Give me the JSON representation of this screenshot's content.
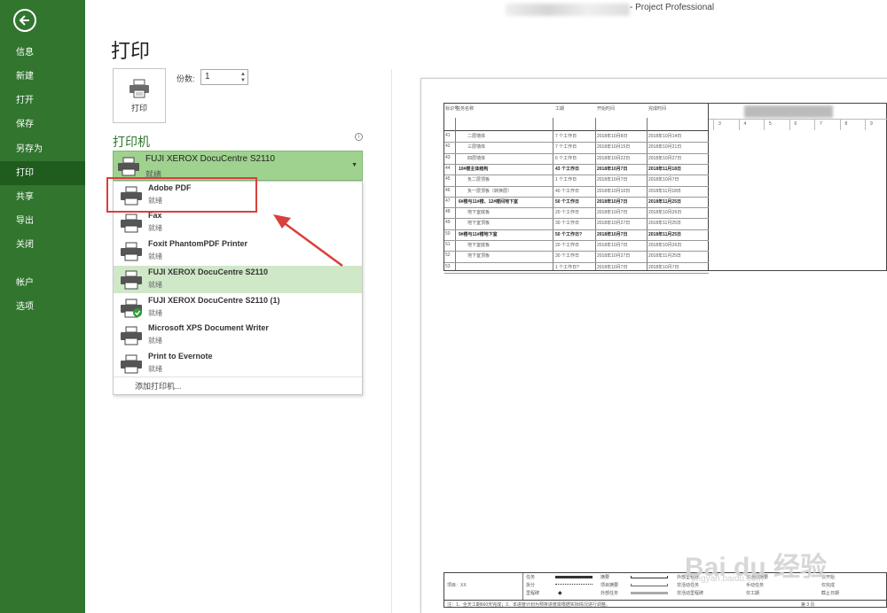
{
  "app": {
    "title": "- Project Professional"
  },
  "nav": {
    "items": [
      {
        "label": "信息",
        "active": false
      },
      {
        "label": "新建",
        "active": false
      },
      {
        "label": "打开",
        "active": false
      },
      {
        "label": "保存",
        "active": false
      },
      {
        "label": "另存为",
        "active": false
      },
      {
        "label": "打印",
        "active": true
      },
      {
        "label": "共享",
        "active": false
      },
      {
        "label": "导出",
        "active": false
      },
      {
        "label": "关闭",
        "active": false
      },
      {
        "label": "帐户",
        "active": false
      },
      {
        "label": "选项",
        "active": false
      }
    ]
  },
  "print": {
    "title": "打印",
    "button_label": "打印",
    "copies_label": "份数:",
    "copies_value": "1",
    "printer_heading": "打印机",
    "selected_printer": {
      "name": "FUJI XEROX DocuCentre S2110",
      "status": "就绪"
    },
    "printers": [
      {
        "name": "Adobe PDF",
        "status": "就绪",
        "active": false,
        "default": false
      },
      {
        "name": "Fax",
        "status": "就绪",
        "active": false,
        "default": false
      },
      {
        "name": "Foxit PhantomPDF Printer",
        "status": "就绪",
        "active": false,
        "default": false
      },
      {
        "name": "FUJI XEROX DocuCentre S2110",
        "status": "就绪",
        "active": true,
        "default": false
      },
      {
        "name": "FUJI XEROX DocuCentre S2110 (1)",
        "status": "就绪",
        "active": false,
        "default": true
      },
      {
        "name": "Microsoft XPS Document Writer",
        "status": "就绪",
        "active": false,
        "default": false
      },
      {
        "name": "Print to Evernote",
        "status": "就绪",
        "active": false,
        "default": false
      }
    ],
    "add_printer": "添加打印机..."
  },
  "preview": {
    "header_cols": [
      "标识号",
      "任务名称",
      "工期",
      "开始时间",
      "完成时间"
    ],
    "timeline_nums": [
      "3",
      "4",
      "5",
      "6",
      "7",
      "8",
      "9"
    ],
    "rows": [
      {
        "id": "41",
        "name": "二层墙体",
        "dur": "7 个工作日",
        "start": "2018年10月8日",
        "end": "2018年10月14日",
        "bold": false
      },
      {
        "id": "42",
        "name": "三层墙体",
        "dur": "7 个工作日",
        "start": "2018年10月15日",
        "end": "2018年10月21日",
        "bold": false
      },
      {
        "id": "43",
        "name": "四层墙体",
        "dur": "6 个工作日",
        "start": "2018年10月22日",
        "end": "2018年10月27日",
        "bold": false
      },
      {
        "id": "44",
        "name": "10#楼主体结构",
        "dur": "43 个工作日",
        "start": "2018年10月7日",
        "end": "2018年11月18日",
        "bold": true
      },
      {
        "id": "45",
        "name": "负二层顶板",
        "dur": "1 个工作日",
        "start": "2018年10月7日",
        "end": "2018年10月7日",
        "bold": false
      },
      {
        "id": "46",
        "name": "负一层顶板（转换层）",
        "dur": "40 个工作日",
        "start": "2018年10月10日",
        "end": "2018年11月18日",
        "bold": false
      },
      {
        "id": "47",
        "name": "6#楼与11#楼、12#楼间地下室",
        "dur": "50 个工作日",
        "start": "2018年10月7日",
        "end": "2018年11月25日",
        "bold": true
      },
      {
        "id": "48",
        "name": "地下室底板",
        "dur": "20 个工作日",
        "start": "2018年10月7日",
        "end": "2018年10月26日",
        "bold": false
      },
      {
        "id": "49",
        "name": "地下室顶板",
        "dur": "30 个工作日",
        "start": "2018年10月27日",
        "end": "2018年11月25日",
        "bold": false
      },
      {
        "id": "50",
        "name": "9#楼与11#楼地下室",
        "dur": "50 个工作日?",
        "start": "2018年10月7日",
        "end": "2018年11月25日",
        "bold": true
      },
      {
        "id": "51",
        "name": "地下室底板",
        "dur": "20 个工作日",
        "start": "2018年10月7日",
        "end": "2018年10月26日",
        "bold": false
      },
      {
        "id": "52",
        "name": "地下室顶板",
        "dur": "30 个工作日",
        "start": "2018年10月27日",
        "end": "2018年11月25日",
        "bold": false
      },
      {
        "id": "53",
        "name": "",
        "dur": "1 个工作日?",
        "start": "2018年10月7日",
        "end": "2018年10月7日",
        "bold": false
      }
    ],
    "footer": {
      "project": "项目：XX",
      "legend": [
        "任务",
        "拆分",
        "里程碑",
        "摘要",
        "项目摘要",
        "外部任务",
        "外部里程碑",
        "非活动任务",
        "非活动里程碑",
        "非活动摘要",
        "手动任务",
        "仅工期",
        "仅开始",
        "仅完成",
        "截止日期",
        "进度",
        "手动进度",
        "手动摘要汇总",
        "手动摘要"
      ],
      "note": "注：1、全天工期660天完成；2、本进度计划为预排进度需根据实际情况进行调整。",
      "page": "第 3 页"
    },
    "watermark": "Bai du 经验",
    "watermark_sub": "jingyan.baidu.com"
  },
  "colors": {
    "nav_bg": "#31752f",
    "nav_active": "#1f5c1d",
    "selected_printer_bg": "#9fd28f",
    "active_item_bg": "#cfe8c8",
    "highlight": "#d9403a",
    "accent_text": "#31752f"
  }
}
